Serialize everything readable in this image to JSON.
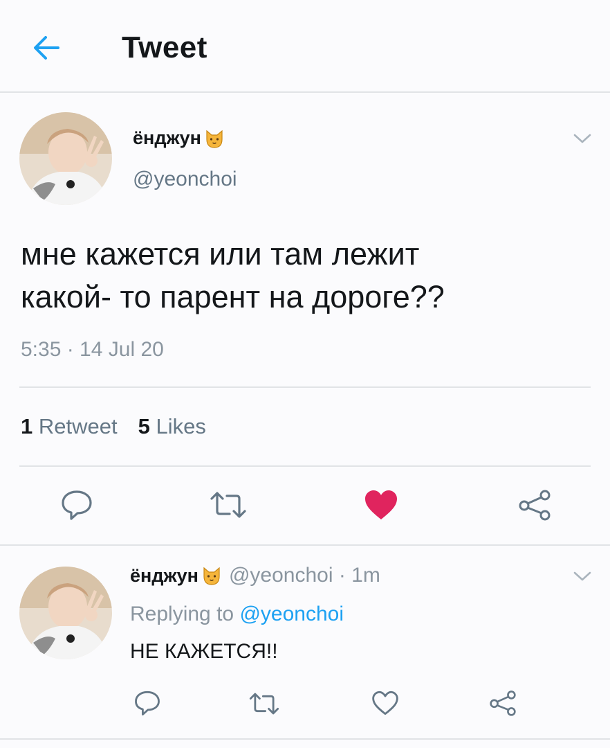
{
  "header": {
    "title": "Tweet",
    "back_icon": "arrow-left-icon"
  },
  "tweet": {
    "author_name": "ёнджун",
    "author_emoji_icon": "cat-face-icon",
    "handle": "@yeonchoi",
    "text_line1": "мне кажется или там лежит",
    "text_line2": "какой- то парент на дороге??",
    "timestamp": "5:35 · 14 Jul 20",
    "retweets_count": "1",
    "retweets_label": "Retweet",
    "likes_count": "5",
    "likes_label": "Likes",
    "liked": true
  },
  "reply": {
    "author_name": "ёнджун",
    "meta": "@yeonchoi · 1m",
    "replying_prefix": "Replying to ",
    "replying_to": "@yeonchoi",
    "text": "НЕ КАЖЕТСЯ!!"
  },
  "colors": {
    "accent": "#1da1f2",
    "like": "#e0245e",
    "muted": "#657786",
    "border": "#e1e3e6"
  }
}
